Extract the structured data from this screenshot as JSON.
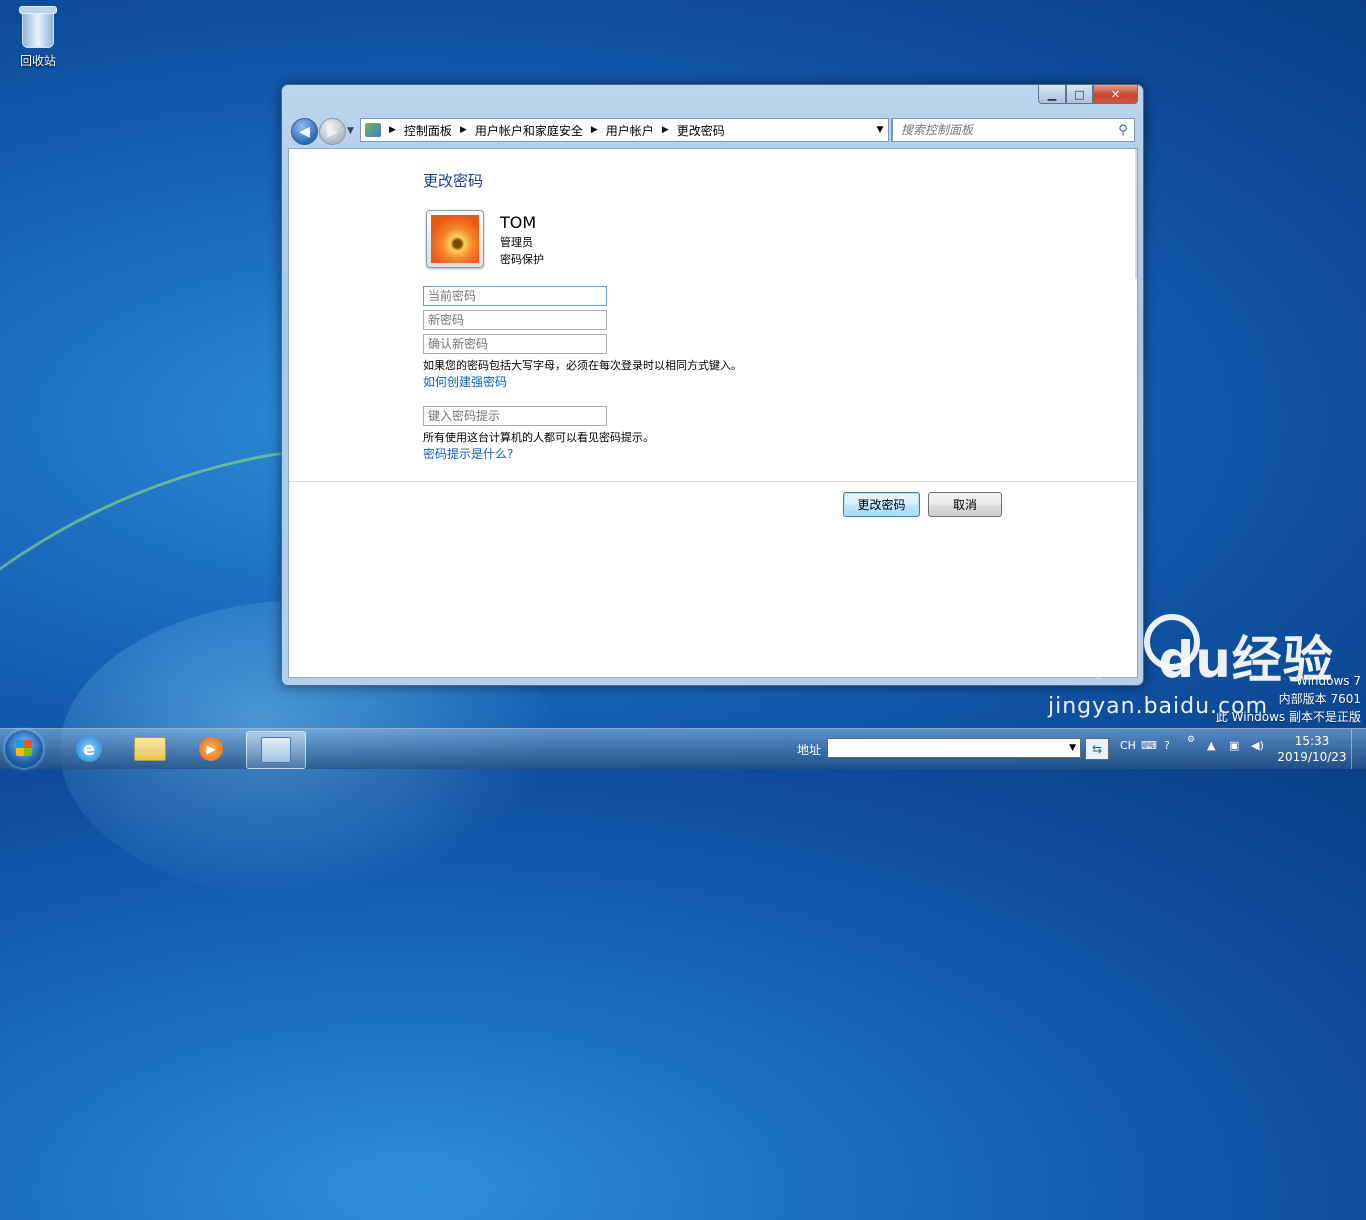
{
  "desktop": {
    "recycle_bin_label": "回收站"
  },
  "window": {
    "buttons": {
      "minimize": "▁",
      "maximize": "□",
      "close": "✕"
    },
    "breadcrumb": [
      "控制面板",
      "用户帐户和家庭安全",
      "用户帐户",
      "更改密码"
    ],
    "search_placeholder": "搜索控制面板"
  },
  "page": {
    "title": "更改密码",
    "user": {
      "name": "TOM",
      "role": "管理员",
      "protection": "密码保护"
    },
    "fields": {
      "current_password_placeholder": "当前密码",
      "new_password_placeholder": "新密码",
      "confirm_password_placeholder": "确认新密码",
      "hint_placeholder": "键入密码提示"
    },
    "case_note": "如果您的密码包括大写字母，必须在每次登录时以相同方式键入。",
    "strong_password_link": "如何创建强密码",
    "hint_note": "所有使用这台计算机的人都可以看见密码提示。",
    "hint_link": "密码提示是什么?",
    "change_button": "更改密码",
    "cancel_button": "取消"
  },
  "watermark": {
    "brand": "Bai  du经验",
    "url": "jingyan.baidu.com"
  },
  "os_notice": {
    "line1": "Windows 7",
    "line2": "内部版本 7601",
    "line3": "此 Windows 副本不是正版"
  },
  "taskbar": {
    "address_label": "地址",
    "language": "CH",
    "time": "15:33",
    "date": "2019/10/23"
  }
}
